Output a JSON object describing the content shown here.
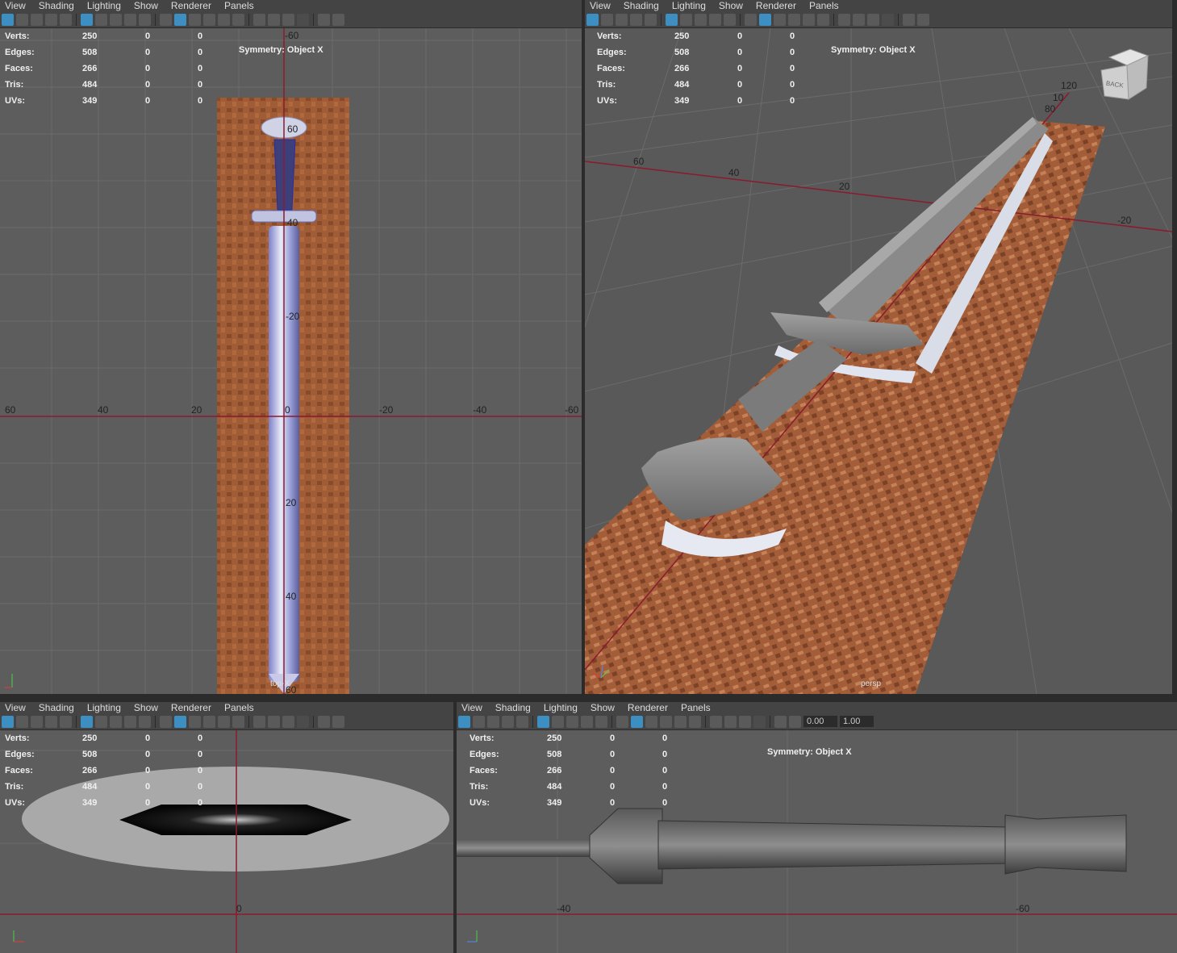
{
  "menus": [
    "View",
    "Shading",
    "Lighting",
    "Show",
    "Renderer",
    "Panels"
  ],
  "hud_labels": [
    "Verts:",
    "Edges:",
    "Faces:",
    "Tris:",
    "UVs:"
  ],
  "hud_values": [
    [
      "250",
      "0",
      "0"
    ],
    [
      "508",
      "0",
      "0"
    ],
    [
      "266",
      "0",
      "0"
    ],
    [
      "484",
      "0",
      "0"
    ],
    [
      "349",
      "0",
      "0"
    ]
  ],
  "symmetry": "Symmetry: Object X",
  "panels": {
    "top": {
      "camera": "top-X",
      "axis_labels": {
        "h": [
          "60",
          "40",
          "20",
          "0",
          "-20",
          "-40",
          "-60"
        ],
        "v": [
          "-60",
          "60",
          "40",
          "-20",
          "20",
          "40",
          "60"
        ]
      }
    },
    "persp": {
      "camera": "persp",
      "viewcube_label": "BACK",
      "axis_labels": [
        "60",
        "40",
        "20",
        "-20",
        "80",
        "120",
        "10"
      ]
    },
    "front": {
      "axis_labels": [
        "0"
      ]
    },
    "side": {
      "axis_labels": [
        "-40",
        "-60"
      ],
      "toolbar_values": {
        "exposure": "0.00",
        "gamma": "1.00"
      }
    }
  },
  "colors": {
    "viewport_bg": "#5d5d5d",
    "grid": "#6b6b6b",
    "axis": "#8b1a2e",
    "active_icon": "#3d8fc2",
    "leather": "#9a5a36"
  }
}
